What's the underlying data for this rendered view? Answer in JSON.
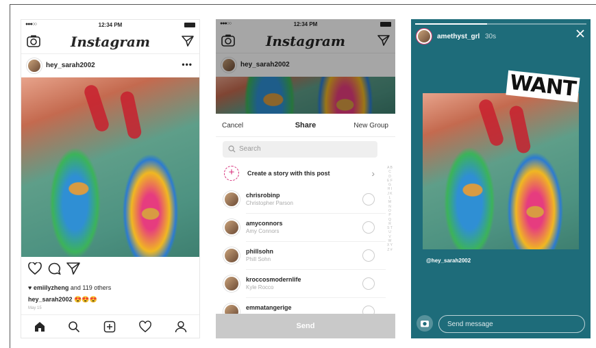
{
  "colors": {
    "story_bg": "#1e6c7a",
    "accent_pink": "#d62976",
    "send_disabled": "#c9c9c9"
  },
  "feed": {
    "status": {
      "signal": "●●●○○",
      "time": "12:34 PM"
    },
    "app_title": "Instagram",
    "post": {
      "username": "hey_sarah2002",
      "more": "•••",
      "likes_user": "emiilyzheng",
      "likes_others": " and 119 others",
      "caption_user": "hey_sarah2002",
      "caption_emoji": "😍😍😍",
      "date": "May 15"
    },
    "icons": {
      "camera": "camera-icon",
      "direct": "paper-plane-icon",
      "like": "heart-icon",
      "comment": "comment-bubble-icon",
      "share": "paper-plane-icon"
    },
    "tabs": [
      "home-icon",
      "search-icon",
      "add-icon",
      "heart-icon",
      "profile-icon"
    ]
  },
  "share": {
    "status": {
      "signal": "●●●○○",
      "time": "12:34 PM"
    },
    "app_title": "Instagram",
    "username": "hey_sarah2002",
    "cancel_label": "Cancel",
    "title": "Share",
    "new_group_label": "New Group",
    "search_placeholder": "Search",
    "story_action": "Create a story with this post",
    "contacts": [
      {
        "username": "chrisrobinp",
        "name": "Christopher Parson"
      },
      {
        "username": "amyconnors",
        "name": "Amy Connors"
      },
      {
        "username": "phillsohn",
        "name": "Phill Sohn"
      },
      {
        "username": "kroccosmodernlife",
        "name": "Kyle Rocco"
      },
      {
        "username": "emmatangerige",
        "name": ""
      }
    ],
    "alphabet": "A B C D E F G H I J K L M N O P Q R S T U V W X Y Z #",
    "send_label": "Send"
  },
  "story": {
    "progress": 0.42,
    "username": "amethyst_grl",
    "time_ago": "30s",
    "sticker_text": "WANT",
    "mention": "@hey_sarah2002",
    "message_placeholder": "Send message"
  }
}
